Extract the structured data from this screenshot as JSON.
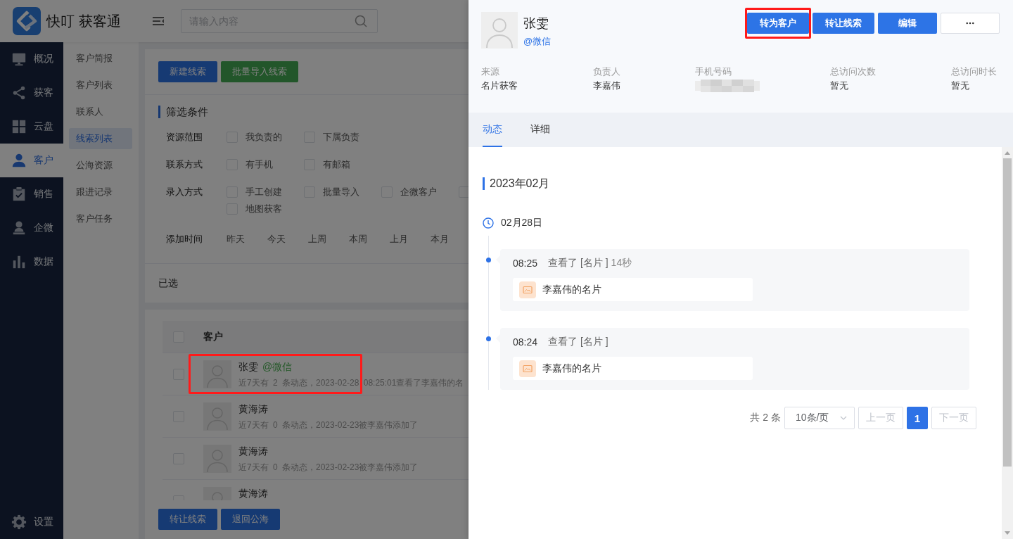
{
  "header": {
    "app_name": "快叮 获客通",
    "search": {
      "placeholder": "请输入内容"
    }
  },
  "nav": {
    "items": [
      {
        "label": "概况",
        "selected": false
      },
      {
        "label": "获客",
        "selected": false
      },
      {
        "label": "云盘",
        "selected": false
      },
      {
        "label": "客户",
        "selected": true
      },
      {
        "label": "销售",
        "selected": false
      },
      {
        "label": "企微",
        "selected": false
      },
      {
        "label": "数据",
        "selected": false
      }
    ],
    "footer_item": {
      "label": "设置",
      "selected": false
    }
  },
  "submenu": {
    "items": [
      {
        "label": "客户简报",
        "selected": false
      },
      {
        "label": "客户列表",
        "selected": false
      },
      {
        "label": "联系人",
        "selected": false
      },
      {
        "label": "线索列表",
        "selected": true
      },
      {
        "label": "公海资源",
        "selected": false
      },
      {
        "label": "跟进记录",
        "selected": false
      },
      {
        "label": "客户任务",
        "selected": false
      }
    ]
  },
  "main": {
    "actions": [
      {
        "label": "新建线索",
        "kind": "primary"
      },
      {
        "label": "批量导入线索",
        "kind": "success"
      }
    ],
    "filter": {
      "title": "筛选条件",
      "groups": [
        {
          "label": "资源范围",
          "kind": "checkbox",
          "options": [
            {
              "label": "我负责的",
              "checked": false
            },
            {
              "label": "下属负责",
              "checked": false
            }
          ]
        },
        {
          "label": "联系方式",
          "kind": "checkbox",
          "options": [
            {
              "label": "有手机",
              "checked": false
            },
            {
              "label": "有邮箱",
              "checked": false
            }
          ]
        },
        {
          "label": "录入方式",
          "kind": "checkbox",
          "options": [
            {
              "label": "手工创建",
              "checked": false
            },
            {
              "label": "批量导入",
              "checked": false
            },
            {
              "label": "企微客户",
              "checked": false
            },
            {
              "checked": false
            },
            {
              "label": "地图获客",
              "checked": false
            }
          ]
        },
        {
          "label": "添加时间",
          "kind": "choice",
          "options": [
            {
              "label": "昨天",
              "selected": false
            },
            {
              "label": "今天",
              "selected": false
            },
            {
              "label": "上周",
              "selected": false
            },
            {
              "label": "本周",
              "selected": false
            },
            {
              "label": "上月",
              "selected": false
            },
            {
              "label": "本月",
              "selected": false
            }
          ]
        }
      ]
    },
    "selected_label": "已选",
    "table": {
      "all_checked": false,
      "columns": [
        "客户"
      ],
      "rows": [
        {
          "checked": false,
          "name": "张雯",
          "channel": "@微信",
          "summary": "近7天有 2 条动态，2023-02-28 08:25:01查看了李嘉伟的名",
          "highlighted": true
        },
        {
          "checked": false,
          "name": "黄海涛",
          "summary": "近7天有 0 条动态，2023-02-23被李嘉伟添加了",
          "highlighted": false
        },
        {
          "checked": false,
          "name": "黄海涛",
          "summary": "近7天有 0 条动态，2023-02-23被李嘉伟添加了",
          "highlighted": false
        },
        {
          "checked": false,
          "name": "黄海涛",
          "highlighted": false
        }
      ]
    },
    "bulk_actions": [
      "转让线索",
      "退回公海"
    ]
  },
  "drawer": {
    "dims_background": true,
    "name": "张雯",
    "channel": "@微信",
    "actions": [
      {
        "label": "转为客户",
        "kind": "primary",
        "highlighted": true
      },
      {
        "label": "转让线索",
        "kind": "primary",
        "highlighted": false
      },
      {
        "label": "编辑",
        "kind": "primary",
        "highlighted": false
      },
      {
        "kind": "more",
        "highlighted": false
      }
    ],
    "fields": [
      {
        "label": "来源",
        "value": "名片获客"
      },
      {
        "label": "负责人",
        "value": "李嘉伟"
      },
      {
        "label": "手机号码",
        "redacted": true
      },
      {
        "label": "总访问次数",
        "value": "暂无"
      },
      {
        "label": "总访问时长",
        "value": "暂无"
      }
    ],
    "tabs": [
      {
        "label": "动态",
        "selected": true
      },
      {
        "label": "详细",
        "selected": false
      }
    ],
    "timeline": {
      "month": "2023年02月",
      "days": [
        {
          "date": "02月28日",
          "events": [
            {
              "time": "08:25",
              "action": "查看了 [名片 ]",
              "duration": "14秒",
              "attachment": "李嘉伟的名片"
            },
            {
              "time": "08:24",
              "action": "查看了 [名片 ]",
              "attachment": "李嘉伟的名片"
            }
          ]
        }
      ]
    },
    "pagination": {
      "total": "共 2 条",
      "page_size": "10条/页",
      "prev": {
        "label": "上一页",
        "disabled": true
      },
      "pages": [
        {
          "label": "1",
          "selected": true
        }
      ],
      "next": {
        "label": "下一页",
        "disabled": true
      }
    }
  }
}
